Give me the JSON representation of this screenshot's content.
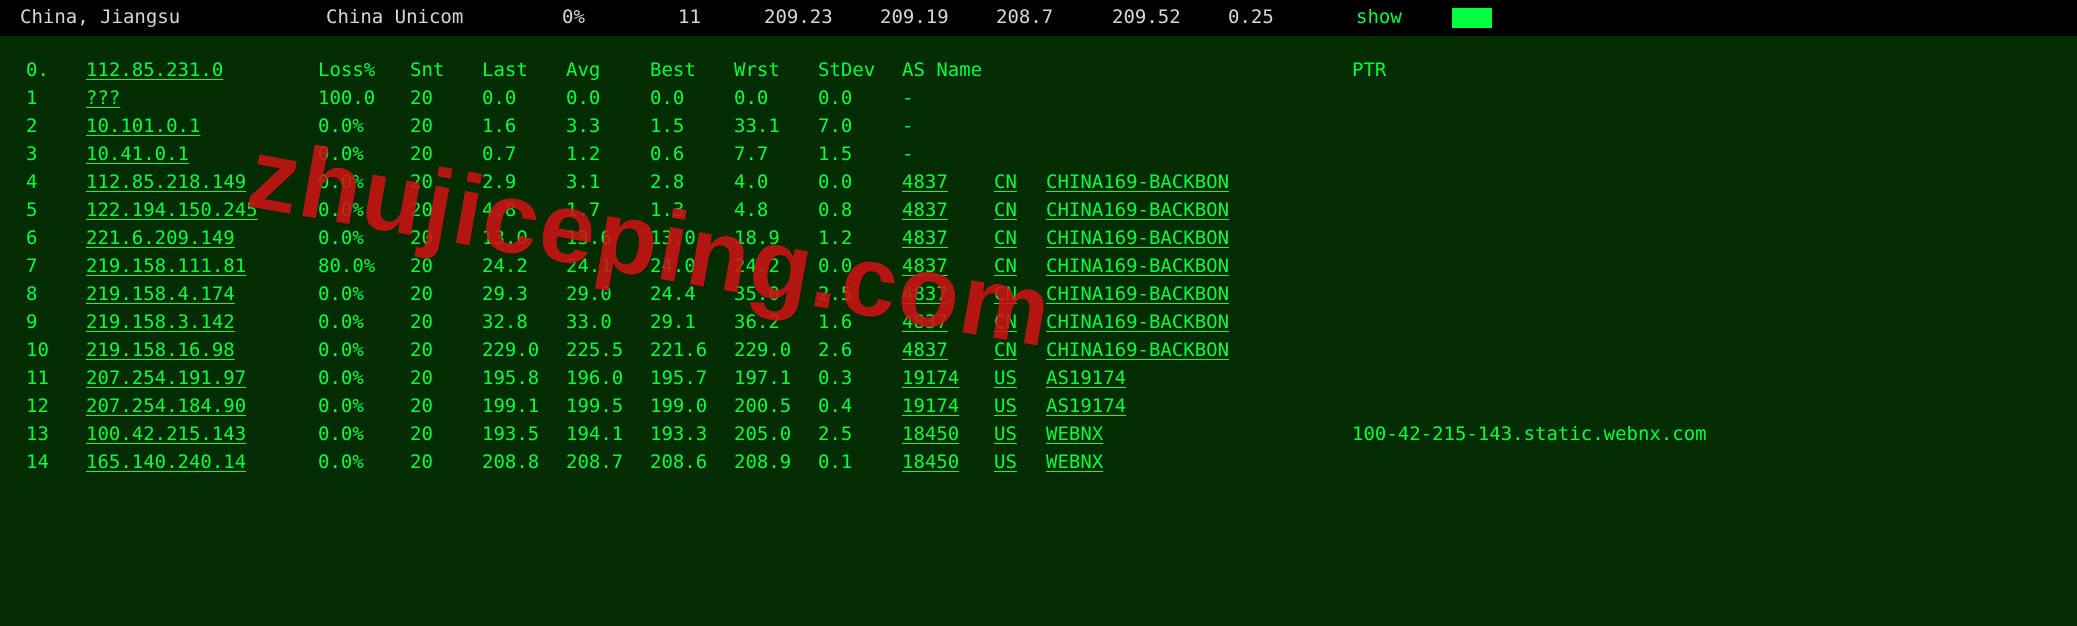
{
  "topbar": {
    "location": "China, Jiangsu",
    "isp": "China Unicom",
    "loss": "0%",
    "snt": "11",
    "last": "209.23",
    "avg": "209.19",
    "best": "208.7",
    "wrst": "209.52",
    "stdev": "0.25",
    "show": "show"
  },
  "headers": {
    "idx": "0.",
    "ip": "112.85.231.0",
    "loss": "Loss%",
    "snt": "Snt",
    "last": "Last",
    "avg": "Avg",
    "best": "Best",
    "wrst": "Wrst",
    "stdev": "StDev",
    "asname": "AS Name",
    "ptr": "PTR"
  },
  "rows": [
    {
      "idx": "1",
      "ip": "???",
      "loss": "100.0",
      "snt": "20",
      "last": "0.0",
      "avg": "0.0",
      "best": "0.0",
      "wrst": "0.0",
      "stdev": "0.0",
      "as": "-",
      "cc": "",
      "asname": "",
      "ptr": ""
    },
    {
      "idx": "2",
      "ip": "10.101.0.1",
      "loss": "0.0%",
      "snt": "20",
      "last": "1.6",
      "avg": "3.3",
      "best": "1.5",
      "wrst": "33.1",
      "stdev": "7.0",
      "as": "-",
      "cc": "",
      "asname": "",
      "ptr": ""
    },
    {
      "idx": "3",
      "ip": "10.41.0.1",
      "loss": "0.0%",
      "snt": "20",
      "last": "0.7",
      "avg": "1.2",
      "best": "0.6",
      "wrst": "7.7",
      "stdev": "1.5",
      "as": "-",
      "cc": "",
      "asname": "",
      "ptr": ""
    },
    {
      "idx": "4",
      "ip": "112.85.218.149",
      "loss": "0.0%",
      "snt": "20",
      "last": "2.9",
      "avg": "3.1",
      "best": "2.8",
      "wrst": "4.0",
      "stdev": "0.0",
      "as": "4837",
      "cc": "CN",
      "asname": "CHINA169-BACKBON",
      "ptr": ""
    },
    {
      "idx": "5",
      "ip": "122.194.150.245",
      "loss": "0.0%",
      "snt": "20",
      "last": "4.8",
      "avg": "1.7",
      "best": "1.3",
      "wrst": "4.8",
      "stdev": "0.8",
      "as": "4837",
      "cc": "CN",
      "asname": "CHINA169-BACKBON",
      "ptr": ""
    },
    {
      "idx": "6",
      "ip": "221.6.209.149",
      "loss": "0.0%",
      "snt": "20",
      "last": "13.0",
      "avg": "13.6",
      "best": "13.0",
      "wrst": "18.9",
      "stdev": "1.2",
      "as": "4837",
      "cc": "CN",
      "asname": "CHINA169-BACKBON",
      "ptr": ""
    },
    {
      "idx": "7",
      "ip": "219.158.111.81",
      "loss": "80.0%",
      "snt": "20",
      "last": "24.2",
      "avg": "24.1",
      "best": "24.0",
      "wrst": "24.2",
      "stdev": "0.0",
      "as": "4837",
      "cc": "CN",
      "asname": "CHINA169-BACKBON",
      "ptr": ""
    },
    {
      "idx": "8",
      "ip": "219.158.4.174",
      "loss": "0.0%",
      "snt": "20",
      "last": "29.3",
      "avg": "29.0",
      "best": "24.4",
      "wrst": "35.0",
      "stdev": "2.5",
      "as": "4837",
      "cc": "CN",
      "asname": "CHINA169-BACKBON",
      "ptr": ""
    },
    {
      "idx": "9",
      "ip": "219.158.3.142",
      "loss": "0.0%",
      "snt": "20",
      "last": "32.8",
      "avg": "33.0",
      "best": "29.1",
      "wrst": "36.2",
      "stdev": "1.6",
      "as": "4837",
      "cc": "CN",
      "asname": "CHINA169-BACKBON",
      "ptr": ""
    },
    {
      "idx": "10",
      "ip": "219.158.16.98",
      "loss": "0.0%",
      "snt": "20",
      "last": "229.0",
      "avg": "225.5",
      "best": "221.6",
      "wrst": "229.0",
      "stdev": "2.6",
      "as": "4837",
      "cc": "CN",
      "asname": "CHINA169-BACKBON",
      "ptr": ""
    },
    {
      "idx": "11",
      "ip": "207.254.191.97",
      "loss": "0.0%",
      "snt": "20",
      "last": "195.8",
      "avg": "196.0",
      "best": "195.7",
      "wrst": "197.1",
      "stdev": "0.3",
      "as": "19174",
      "cc": "US",
      "asname": "AS19174",
      "ptr": ""
    },
    {
      "idx": "12",
      "ip": "207.254.184.90",
      "loss": "0.0%",
      "snt": "20",
      "last": "199.1",
      "avg": "199.5",
      "best": "199.0",
      "wrst": "200.5",
      "stdev": "0.4",
      "as": "19174",
      "cc": "US",
      "asname": "AS19174",
      "ptr": ""
    },
    {
      "idx": "13",
      "ip": "100.42.215.143",
      "loss": "0.0%",
      "snt": "20",
      "last": "193.5",
      "avg": "194.1",
      "best": "193.3",
      "wrst": "205.0",
      "stdev": "2.5",
      "as": "18450",
      "cc": "US",
      "asname": "WEBNX",
      "ptr": "100-42-215-143.static.webnx.com"
    },
    {
      "idx": "14",
      "ip": "165.140.240.14",
      "loss": "0.0%",
      "snt": "20",
      "last": "208.8",
      "avg": "208.7",
      "best": "208.6",
      "wrst": "208.9",
      "stdev": "0.1",
      "as": "18450",
      "cc": "US",
      "asname": "WEBNX",
      "ptr": ""
    }
  ],
  "watermark": "zhujiceping.com"
}
